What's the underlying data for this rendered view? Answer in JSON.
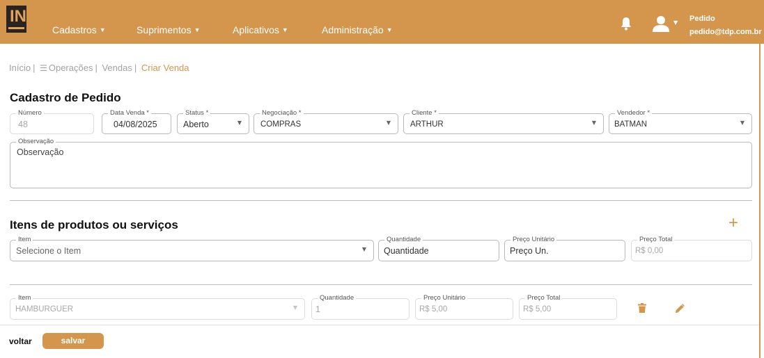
{
  "navbar": {
    "logo_text": "IN",
    "menu": [
      {
        "label": "Cadastros"
      },
      {
        "label": "Suprimentos"
      },
      {
        "label": "Aplicativos"
      },
      {
        "label": "Administração"
      }
    ],
    "user": {
      "name": "Pedido",
      "email": "pedido@tdp.com.br"
    }
  },
  "breadcrumb": {
    "items": [
      "Início",
      "Operações",
      "Vendas"
    ],
    "current": "Criar Venda"
  },
  "form": {
    "title": "Cadastro de Pedido",
    "numero": {
      "label": "Número",
      "value": "48"
    },
    "data_venda": {
      "label": "Data Venda *",
      "value": "04/08/2025"
    },
    "status": {
      "label": "Status *",
      "value": "Aberto"
    },
    "negociacao": {
      "label": "Negociação *",
      "value": "COMPRAS"
    },
    "cliente": {
      "label": "Cliente *",
      "value": "ARTHUR"
    },
    "vendedor": {
      "label": "Vendedor *",
      "value": "BATMAN"
    },
    "observacao": {
      "label": "Observação",
      "placeholder": "Observação"
    }
  },
  "items_section": {
    "title": "Itens de produtos ou serviços",
    "new_item": {
      "item": {
        "label": "Item",
        "placeholder": "Selecione o Item"
      },
      "quantidade": {
        "label": "Quantidade",
        "placeholder": "Quantidade"
      },
      "preco_unitario": {
        "label": "Preço Unitário",
        "placeholder": "Preço Un."
      },
      "preco_total": {
        "label": "Preço Total",
        "value": "R$ 0,00"
      }
    },
    "rows": [
      {
        "item": {
          "label": "Item",
          "value": "HAMBURGUER"
        },
        "quantidade": {
          "label": "Quantidade",
          "value": "1"
        },
        "preco_unitario": {
          "label": "Preço Unitário",
          "value": "R$ 5,00"
        },
        "preco_total": {
          "label": "Preço Total",
          "value": "R$ 5,00"
        }
      }
    ]
  },
  "footer": {
    "back_label": "voltar",
    "save_label": "salvar"
  },
  "colors": {
    "accent": "#d4964c",
    "logo_bg": "#2a2320",
    "border": "#b9b9b9",
    "muted_text": "#a8a8a8"
  }
}
